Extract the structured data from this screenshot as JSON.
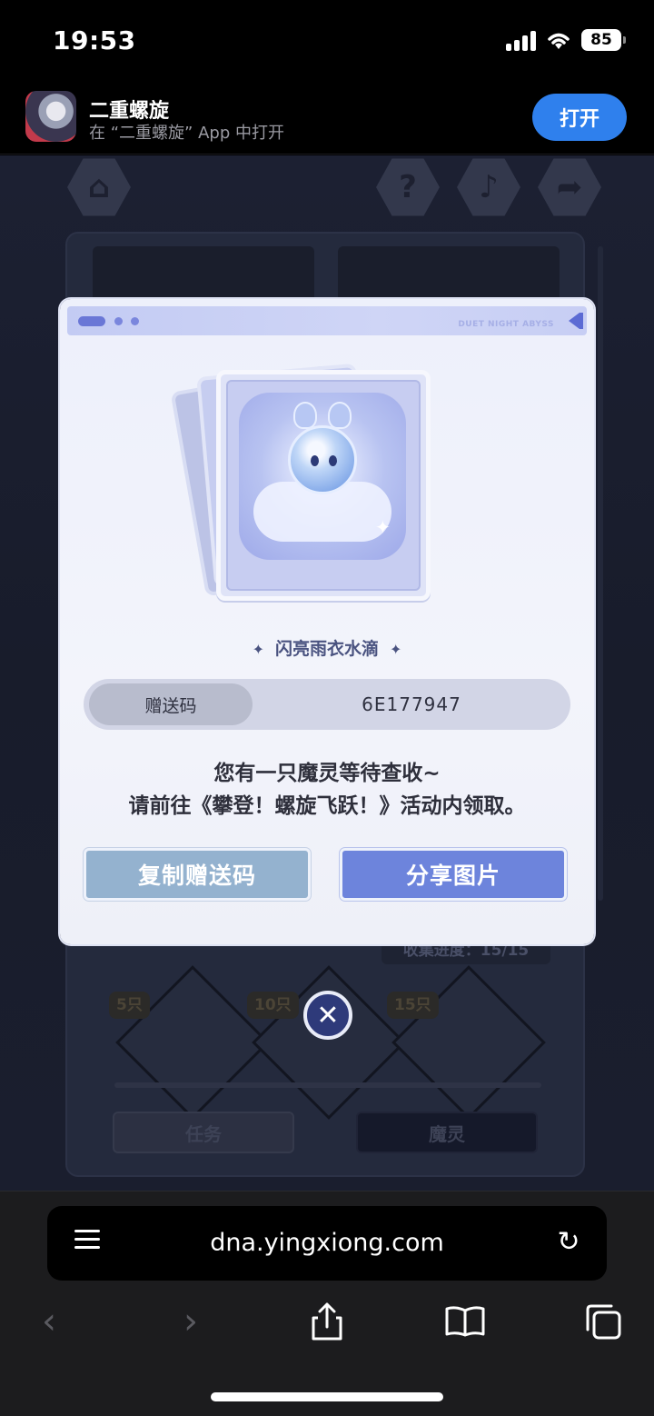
{
  "status_bar": {
    "time": "19:53",
    "battery": "85"
  },
  "app_banner": {
    "name": "二重螺旋",
    "subtitle": "在 “二重螺旋” App 中打开",
    "open_label": "打开"
  },
  "modal": {
    "header_text": "DUET NIGHT ABYSS",
    "item_name": "闪亮雨衣水滴",
    "code_label": "赠送码",
    "code_value": "6E177947",
    "message_line1": "您有一只魔灵等待查收~",
    "message_line2": "请前往《攀登！螺旋飞跃！》活动内领取。",
    "copy_button": "复制赠送码",
    "share_button": "分享图片",
    "close_glyph": "✕"
  },
  "background_page": {
    "progress": "收集进度：15/15",
    "badges": [
      "5只",
      "10只",
      "15只"
    ],
    "tabs": [
      "任务",
      "魔灵"
    ]
  },
  "browser": {
    "url": "dna.yingxiong.com"
  },
  "icons": {
    "home": "home-icon",
    "help": "question-icon",
    "music": "music-icon",
    "share": "share-icon",
    "back": "chevron-left-icon",
    "forward": "chevron-right-icon",
    "share_sheet": "share-sheet-icon",
    "bookmarks": "book-icon",
    "tabs": "tabs-icon",
    "reload": "reload-icon",
    "page_menu": "page-menu-icon"
  },
  "colors": {
    "open_button": "#2f80ed",
    "copy_button": "#94b2cf",
    "share_button": "#6d84dc",
    "item_name": "#4a5380"
  }
}
